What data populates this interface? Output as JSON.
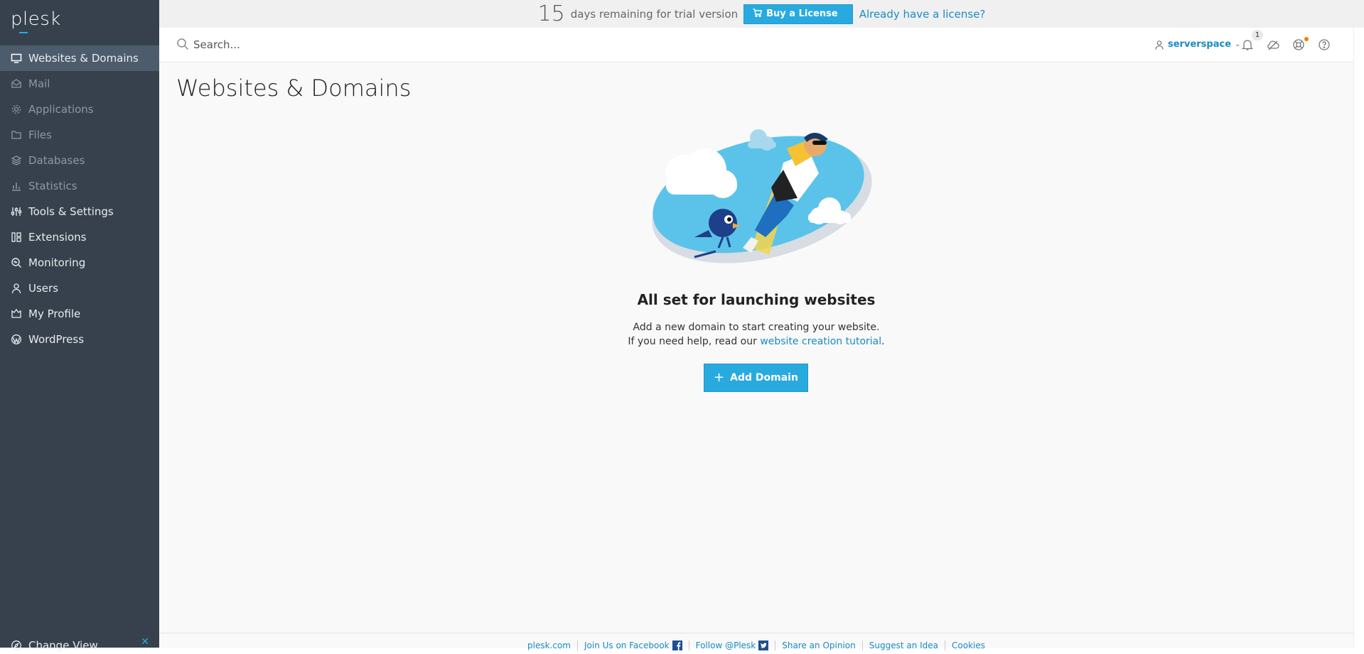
{
  "app": {
    "logo": "plesk"
  },
  "trial": {
    "days": "15",
    "message": "days remaining for trial version",
    "buy_label": "Buy a License",
    "have_license": "Already have a license?"
  },
  "header": {
    "search_placeholder": "Search...",
    "user": "serverspace",
    "notification_count": "1"
  },
  "sidebar": {
    "items": [
      {
        "label": "Websites & Domains",
        "icon": "monitor-icon"
      },
      {
        "label": "Mail",
        "icon": "mail-icon"
      },
      {
        "label": "Applications",
        "icon": "gear-icon"
      },
      {
        "label": "Files",
        "icon": "folder-icon"
      },
      {
        "label": "Databases",
        "icon": "layers-icon"
      },
      {
        "label": "Statistics",
        "icon": "bar-chart-icon"
      },
      {
        "label": "Tools & Settings",
        "icon": "sliders-icon"
      },
      {
        "label": "Extensions",
        "icon": "grid-icon"
      },
      {
        "label": "Monitoring",
        "icon": "magnifier-icon"
      },
      {
        "label": "Users",
        "icon": "user-icon"
      },
      {
        "label": "My Profile",
        "icon": "profile-icon"
      },
      {
        "label": "WordPress",
        "icon": "wordpress-icon"
      }
    ],
    "change_view": "Change View"
  },
  "main": {
    "title": "Websites & Domains",
    "empty_title": "All set for launching websites",
    "empty_line1": "Add a new domain to start creating your website.",
    "empty_line2_prefix": "If you need help, read our ",
    "empty_link": "website creation tutorial",
    "empty_line2_suffix": ".",
    "add_domain": "Add Domain"
  },
  "footer": {
    "links": [
      "plesk.com",
      "Join Us on Facebook",
      "Follow @Plesk",
      "Share an Opinion",
      "Suggest an Idea",
      "Cookies"
    ]
  },
  "colors": {
    "sidebar_bg": "#36414d",
    "sidebar_active": "#4d5c6c",
    "accent": "#28aade",
    "link": "#1a8bc4"
  }
}
